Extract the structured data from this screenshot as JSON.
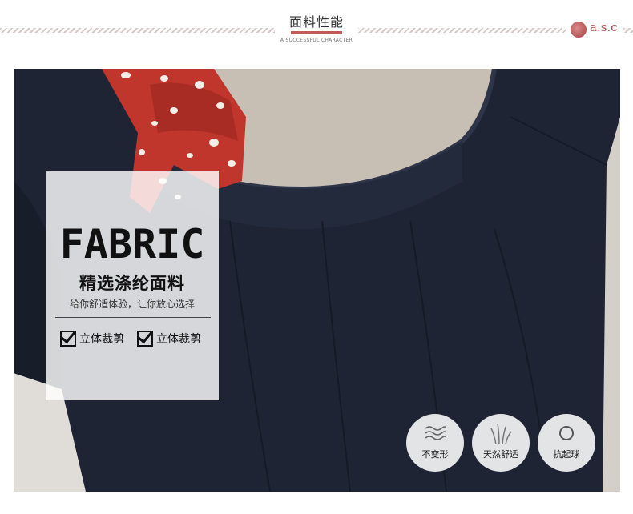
{
  "header": {
    "title": "面料性能",
    "subtitle": "A SUCCESSFUL CHARACTER",
    "logo_text": "a.s.c",
    "accent_color": "#c25a5a"
  },
  "photo": {
    "subject": "navy-jacket-back-with-polka-dot-scarf",
    "jacket_color": "#1e2433",
    "scarf_color": "#c0362c"
  },
  "panel": {
    "heading": "FABRIC",
    "subheading": "精选涤纶面料",
    "tagline": "给你舒适体验，让你放心选择",
    "features": [
      {
        "icon": "checkbox-icon",
        "label": "立体裁剪"
      },
      {
        "icon": "checkbox-icon",
        "label": "立体裁剪"
      }
    ]
  },
  "badges": [
    {
      "icon": "wave-icon",
      "label": "不变形"
    },
    {
      "icon": "grass-icon",
      "label": "天然舒适"
    },
    {
      "icon": "ring-icon",
      "label": "抗起球"
    }
  ]
}
